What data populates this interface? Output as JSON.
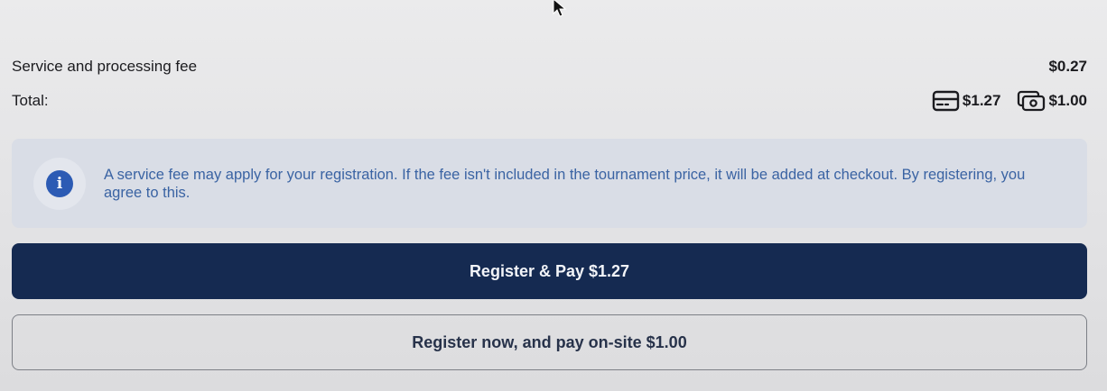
{
  "fee": {
    "label": "Service and processing fee",
    "value": "$0.27"
  },
  "total": {
    "label": "Total:",
    "card_icon": "credit-card-icon",
    "card_amount": "$1.27",
    "cash_icon": "cash-icon",
    "cash_amount": "$1.00"
  },
  "info": {
    "icon": "info-icon",
    "text": "A service fee may apply for your registration. If the fee isn't included in the tournament price, it will be added at checkout. By registering, you agree to this."
  },
  "buttons": {
    "primary_label": "Register & Pay $1.27",
    "secondary_label": "Register now, and pay on-site $1.00"
  },
  "colors": {
    "primary_button": "#152a51",
    "info_background": "#d9dde6",
    "info_text": "#3a63a3",
    "info_icon": "#2c5bb4"
  }
}
